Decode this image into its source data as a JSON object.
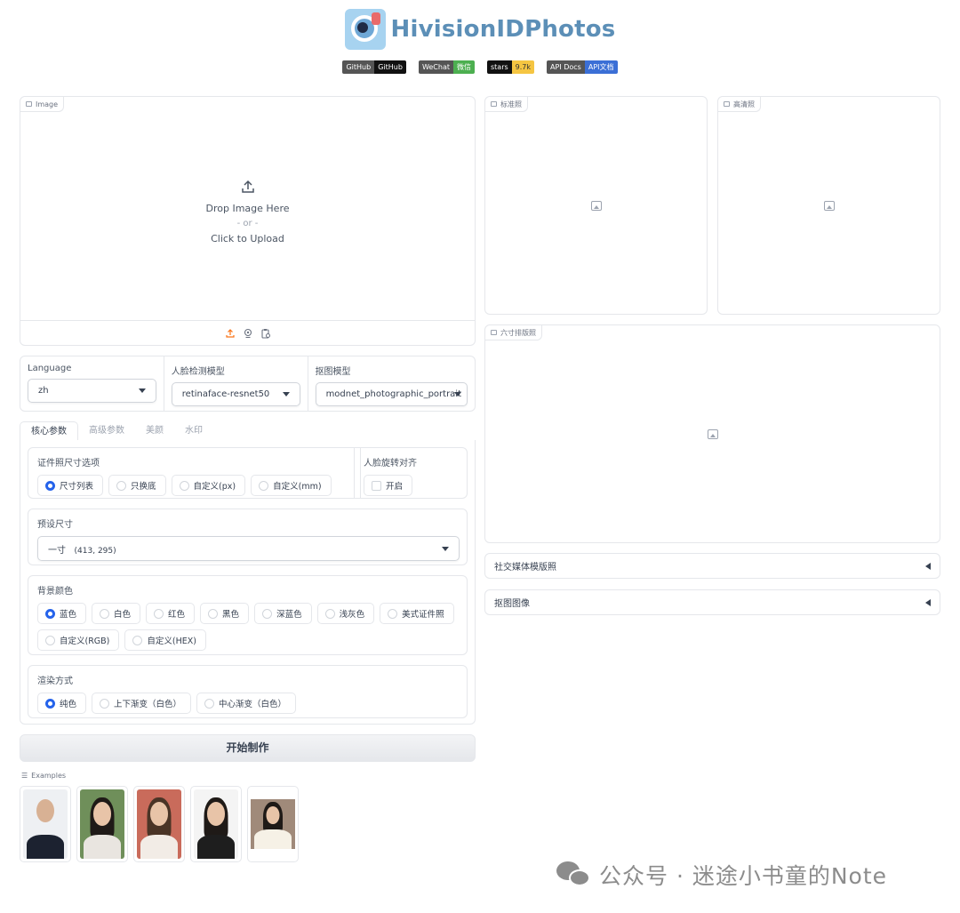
{
  "header": {
    "title": "HivisionIDPhotos",
    "badges": [
      {
        "left": "GitHub",
        "right": "GitHub",
        "color": "#111111"
      },
      {
        "left": "WeChat",
        "right": "微信",
        "color": "#4caf50"
      },
      {
        "left": "stars",
        "right": "9.7k",
        "color": "#f5c542"
      },
      {
        "left": "API Docs",
        "right": "API文档",
        "color": "#3b6fd6"
      }
    ]
  },
  "upload": {
    "tag": "Image",
    "drop_text": "Drop Image Here",
    "or_text": "- or -",
    "click_text": "Click to Upload",
    "footer_icons": [
      "upload-icon",
      "webcam-icon",
      "clipboard-icon"
    ]
  },
  "models": {
    "language": {
      "label": "Language",
      "value": "zh"
    },
    "face_model": {
      "label": "人脸检测模型",
      "value": "retinaface-resnet50"
    },
    "matting_model": {
      "label": "抠图模型",
      "value": "modnet_photographic_portrait"
    }
  },
  "tabs": [
    "核心参数",
    "高级参数",
    "美颜",
    "水印"
  ],
  "size_options": {
    "label": "证件照尺寸选项",
    "options": [
      "尺寸列表",
      "只换底",
      "自定义(px)",
      "自定义(mm)"
    ],
    "selected": 0
  },
  "face_align": {
    "label": "人脸旋转对齐",
    "checkbox_label": "开启",
    "checked": false
  },
  "preset_size": {
    "label": "预设尺寸",
    "name": "一寸",
    "dims": "(413, 295)"
  },
  "bg_color": {
    "label": "背景颜色",
    "options": [
      "蓝色",
      "白色",
      "红色",
      "黑色",
      "深蓝色",
      "浅灰色",
      "美式证件照",
      "自定义(RGB)",
      "自定义(HEX)"
    ],
    "selected": 0
  },
  "render_mode": {
    "label": "渲染方式",
    "options": [
      "纯色",
      "上下渐变（白色）",
      "中心渐变（白色）"
    ],
    "selected": 0
  },
  "start_button": "开始制作",
  "examples": {
    "label": "Examples"
  },
  "outputs": {
    "standard": "标准照",
    "hd": "高清照",
    "layout": "六寸排版照"
  },
  "accordions": [
    "社交媒体模版照",
    "抠图图像"
  ],
  "watermark": "公众号 · 迷途小书童的Note"
}
